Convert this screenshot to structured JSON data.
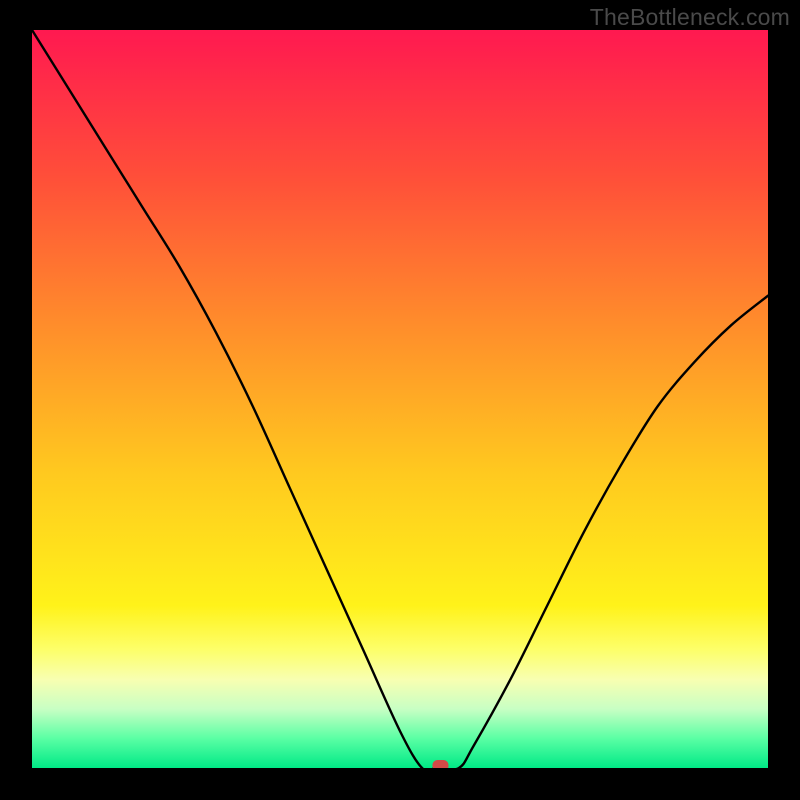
{
  "watermark": "TheBottleneck.com",
  "chart_data": {
    "type": "line",
    "title": "",
    "xlabel": "",
    "ylabel": "",
    "xlim": [
      0,
      100
    ],
    "ylim": [
      0,
      100
    ],
    "x": [
      0,
      5,
      10,
      15,
      20,
      25,
      30,
      35,
      40,
      45,
      50,
      53,
      55,
      58,
      60,
      65,
      70,
      75,
      80,
      85,
      90,
      95,
      100
    ],
    "values": [
      100,
      92,
      84,
      76,
      68,
      59,
      49,
      38,
      27,
      16,
      5,
      0,
      0,
      0,
      3,
      12,
      22,
      32,
      41,
      49,
      55,
      60,
      64
    ],
    "minimum_marker": {
      "x": 55.5,
      "y": 0
    },
    "background_gradient": {
      "stops": [
        {
          "offset": 0.0,
          "color": "#ff1950"
        },
        {
          "offset": 0.2,
          "color": "#ff4f39"
        },
        {
          "offset": 0.4,
          "color": "#ff8d2b"
        },
        {
          "offset": 0.6,
          "color": "#ffc91f"
        },
        {
          "offset": 0.78,
          "color": "#fff21a"
        },
        {
          "offset": 0.84,
          "color": "#fdff6a"
        },
        {
          "offset": 0.88,
          "color": "#f8ffb1"
        },
        {
          "offset": 0.92,
          "color": "#c8ffc4"
        },
        {
          "offset": 0.96,
          "color": "#5affa4"
        },
        {
          "offset": 1.0,
          "color": "#00e986"
        }
      ]
    }
  }
}
